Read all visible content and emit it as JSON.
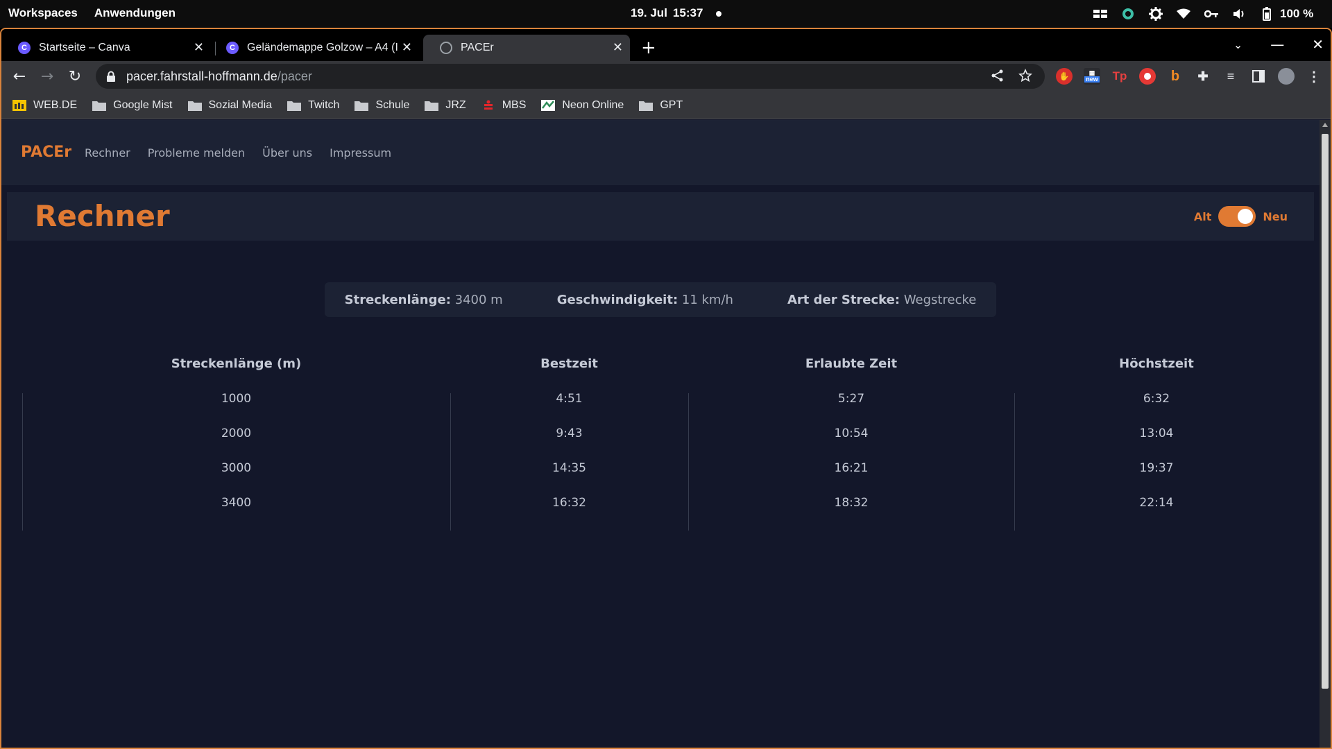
{
  "system": {
    "workspaces": "Workspaces",
    "applications": "Anwendungen",
    "date": "19. Jul",
    "time": "15:37",
    "battery": "100 %"
  },
  "browser": {
    "tabs": [
      {
        "title": "Startseite – Canva",
        "favicon": "canva-icon"
      },
      {
        "title": "Geländemappe Golzow – A4 (I",
        "favicon": "canva-icon"
      },
      {
        "title": "PACEr",
        "favicon": "globe-icon"
      }
    ],
    "url_host": "pacer.fahrstall-hoffmann.de",
    "url_path": "/pacer",
    "extension_new_badge": "new",
    "bookmarks": [
      {
        "label": "WEB.DE",
        "icon": "webde-icon"
      },
      {
        "label": "Google Mist",
        "icon": "folder-icon"
      },
      {
        "label": "Sozial Media",
        "icon": "folder-icon"
      },
      {
        "label": "Twitch",
        "icon": "folder-icon"
      },
      {
        "label": "Schule",
        "icon": "folder-icon"
      },
      {
        "label": "JRZ",
        "icon": "folder-icon"
      },
      {
        "label": "MBS",
        "icon": "sparkasse-icon"
      },
      {
        "label": "Neon Online",
        "icon": "neon-icon"
      },
      {
        "label": "GPT",
        "icon": "folder-icon"
      }
    ]
  },
  "site": {
    "brand": "PACEr",
    "nav": [
      "Rechner",
      "Probleme melden",
      "Über uns",
      "Impressum"
    ],
    "page_title": "Rechner",
    "toggle_left": "Alt",
    "toggle_right": "Neu",
    "info": {
      "length_label": "Streckenlänge:",
      "length_value": "3400 m",
      "speed_label": "Geschwindigkeit:",
      "speed_value": "11 km/h",
      "type_label": "Art der Strecke:",
      "type_value": "Wegstrecke"
    },
    "table": {
      "headers": [
        "Streckenlänge (m)",
        "Bestzeit",
        "Erlaubte Zeit",
        "Höchstzeit"
      ],
      "rows": [
        [
          "1000",
          "4:51",
          "5:27",
          "6:32"
        ],
        [
          "2000",
          "9:43",
          "10:54",
          "13:04"
        ],
        [
          "3000",
          "14:35",
          "16:21",
          "19:37"
        ],
        [
          "3400",
          "16:32",
          "18:32",
          "22:14"
        ]
      ]
    }
  },
  "colors": {
    "accent": "#e07a33",
    "page_bg": "#13172a",
    "panel_bg": "#1c2234"
  }
}
